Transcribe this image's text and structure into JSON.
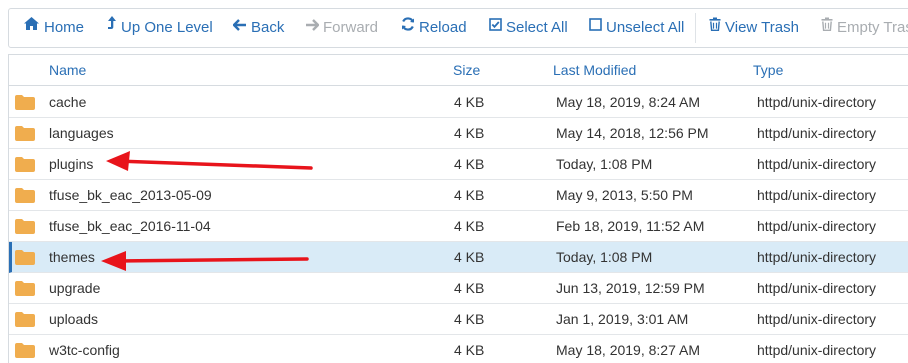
{
  "toolbar": {
    "home": "Home",
    "up_one_level": "Up One Level",
    "back": "Back",
    "forward": "Forward",
    "reload": "Reload",
    "select_all": "Select All",
    "unselect_all": "Unselect All",
    "view_trash": "View Trash",
    "empty_trash": "Empty Tras"
  },
  "columns": {
    "name": "Name",
    "size": "Size",
    "last_modified": "Last Modified",
    "type": "Type"
  },
  "rows": [
    {
      "name": "cache",
      "size": "4 KB",
      "modified": "May 18, 2019, 8:24 AM",
      "type": "httpd/unix-directory"
    },
    {
      "name": "languages",
      "size": "4 KB",
      "modified": "May 14, 2018, 12:56 PM",
      "type": "httpd/unix-directory"
    },
    {
      "name": "plugins",
      "size": "4 KB",
      "modified": "Today, 1:08 PM",
      "type": "httpd/unix-directory"
    },
    {
      "name": "tfuse_bk_eac_2013-05-09",
      "size": "4 KB",
      "modified": "May 9, 2013, 5:50 PM",
      "type": "httpd/unix-directory"
    },
    {
      "name": "tfuse_bk_eac_2016-11-04",
      "size": "4 KB",
      "modified": "Feb 18, 2019, 11:52 AM",
      "type": "httpd/unix-directory"
    },
    {
      "name": "themes",
      "size": "4 KB",
      "modified": "Today, 1:08 PM",
      "type": "httpd/unix-directory"
    },
    {
      "name": "upgrade",
      "size": "4 KB",
      "modified": "Jun 13, 2019, 12:59 PM",
      "type": "httpd/unix-directory"
    },
    {
      "name": "uploads",
      "size": "4 KB",
      "modified": "Jan 1, 2019, 3:01 AM",
      "type": "httpd/unix-directory"
    },
    {
      "name": "w3tc-config",
      "size": "4 KB",
      "modified": "May 18, 2019, 8:27 AM",
      "type": "httpd/unix-directory"
    }
  ],
  "colors": {
    "accent": "#2a6fb5",
    "folder": "#f0ad4e",
    "selected_row": "#d9ebf7",
    "annotation_arrow": "#e8141b"
  }
}
